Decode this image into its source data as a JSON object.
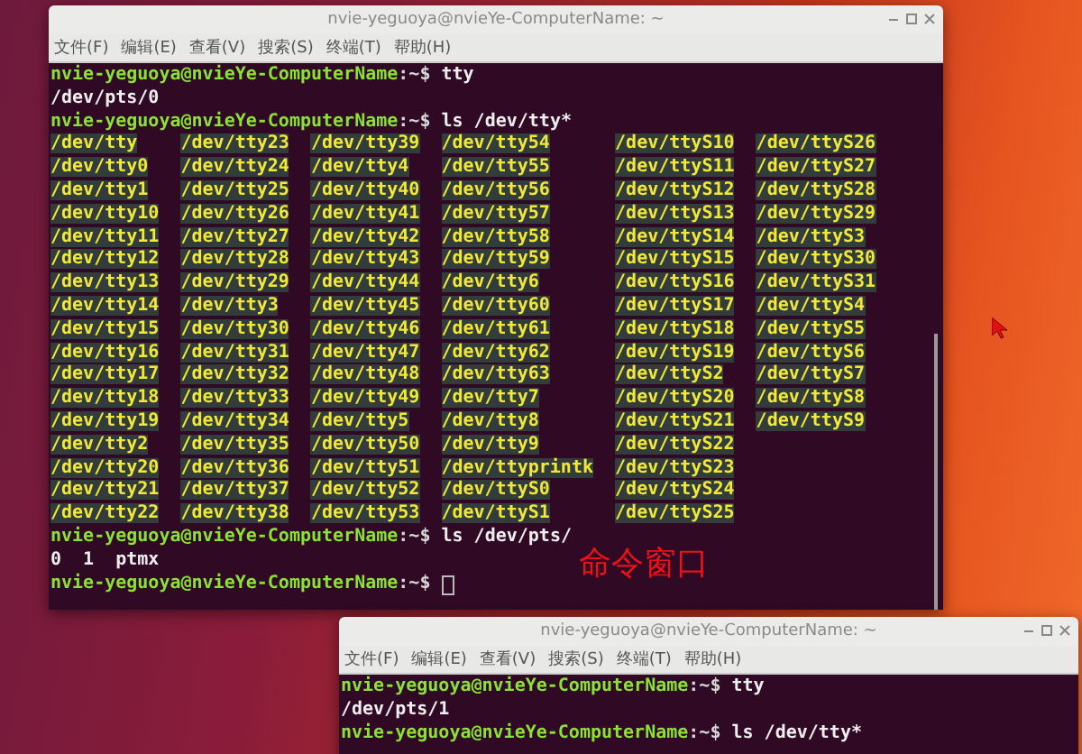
{
  "windows": [
    {
      "title": "nvie-yeguoya@nvieYe-ComputerName: ~",
      "menu": [
        "文件(F)",
        "编辑(E)",
        "查看(V)",
        "搜索(S)",
        "终端(T)",
        "帮助(H)"
      ],
      "lines": [
        {
          "kind": "prompt",
          "user": "nvie-yeguoya@nvieYe-ComputerName",
          "suffix": ":~$",
          "command": "tty"
        },
        {
          "kind": "output",
          "text": "/dev/pts/0"
        },
        {
          "kind": "prompt",
          "user": "nvie-yeguoya@nvieYe-ComputerName",
          "suffix": ":~$",
          "command": "ls /dev/tty*"
        },
        {
          "kind": "listing",
          "rows": [
            [
              "/dev/tty",
              "/dev/tty23",
              "/dev/tty39",
              "/dev/tty54",
              "/dev/ttyS10",
              "/dev/ttyS26"
            ],
            [
              "/dev/tty0",
              "/dev/tty24",
              "/dev/tty4",
              "/dev/tty55",
              "/dev/ttyS11",
              "/dev/ttyS27"
            ],
            [
              "/dev/tty1",
              "/dev/tty25",
              "/dev/tty40",
              "/dev/tty56",
              "/dev/ttyS12",
              "/dev/ttyS28"
            ],
            [
              "/dev/tty10",
              "/dev/tty26",
              "/dev/tty41",
              "/dev/tty57",
              "/dev/ttyS13",
              "/dev/ttyS29"
            ],
            [
              "/dev/tty11",
              "/dev/tty27",
              "/dev/tty42",
              "/dev/tty58",
              "/dev/ttyS14",
              "/dev/ttyS3"
            ],
            [
              "/dev/tty12",
              "/dev/tty28",
              "/dev/tty43",
              "/dev/tty59",
              "/dev/ttyS15",
              "/dev/ttyS30"
            ],
            [
              "/dev/tty13",
              "/dev/tty29",
              "/dev/tty44",
              "/dev/tty6",
              "/dev/ttyS16",
              "/dev/ttyS31"
            ],
            [
              "/dev/tty14",
              "/dev/tty3",
              "/dev/tty45",
              "/dev/tty60",
              "/dev/ttyS17",
              "/dev/ttyS4"
            ],
            [
              "/dev/tty15",
              "/dev/tty30",
              "/dev/tty46",
              "/dev/tty61",
              "/dev/ttyS18",
              "/dev/ttyS5"
            ],
            [
              "/dev/tty16",
              "/dev/tty31",
              "/dev/tty47",
              "/dev/tty62",
              "/dev/ttyS19",
              "/dev/ttyS6"
            ],
            [
              "/dev/tty17",
              "/dev/tty32",
              "/dev/tty48",
              "/dev/tty63",
              "/dev/ttyS2",
              "/dev/ttyS7"
            ],
            [
              "/dev/tty18",
              "/dev/tty33",
              "/dev/tty49",
              "/dev/tty7",
              "/dev/ttyS20",
              "/dev/ttyS8"
            ],
            [
              "/dev/tty19",
              "/dev/tty34",
              "/dev/tty5",
              "/dev/tty8",
              "/dev/ttyS21",
              "/dev/ttyS9"
            ],
            [
              "/dev/tty2",
              "/dev/tty35",
              "/dev/tty50",
              "/dev/tty9",
              "/dev/ttyS22"
            ],
            [
              "/dev/tty20",
              "/dev/tty36",
              "/dev/tty51",
              "/dev/ttyprintk",
              "/dev/ttyS23"
            ],
            [
              "/dev/tty21",
              "/dev/tty37",
              "/dev/tty52",
              "/dev/ttyS0",
              "/dev/ttyS24"
            ],
            [
              "/dev/tty22",
              "/dev/tty38",
              "/dev/tty53",
              "/dev/ttyS1",
              "/dev/ttyS25"
            ]
          ]
        },
        {
          "kind": "prompt",
          "user": "nvie-yeguoya@nvieYe-ComputerName",
          "suffix": ":~$",
          "command": "ls /dev/pts/"
        },
        {
          "kind": "output",
          "text": "0  1  ptmx"
        },
        {
          "kind": "prompt",
          "user": "nvie-yeguoya@nvieYe-ComputerName",
          "suffix": ":~$",
          "cursor": true
        }
      ]
    },
    {
      "title": "nvie-yeguoya@nvieYe-ComputerName: ~",
      "menu": [
        "文件(F)",
        "编辑(E)",
        "查看(V)",
        "搜索(S)",
        "终端(T)",
        "帮助(H)"
      ],
      "lines": [
        {
          "kind": "prompt",
          "user": "nvie-yeguoya@nvieYe-ComputerName",
          "suffix": ":~$",
          "command": "tty"
        },
        {
          "kind": "output",
          "text": "/dev/pts/1"
        },
        {
          "kind": "prompt",
          "user": "nvie-yeguoya@nvieYe-ComputerName",
          "suffix": ":~$",
          "command": "ls /dev/tty*"
        }
      ]
    }
  ],
  "annotation": "命令窗口"
}
